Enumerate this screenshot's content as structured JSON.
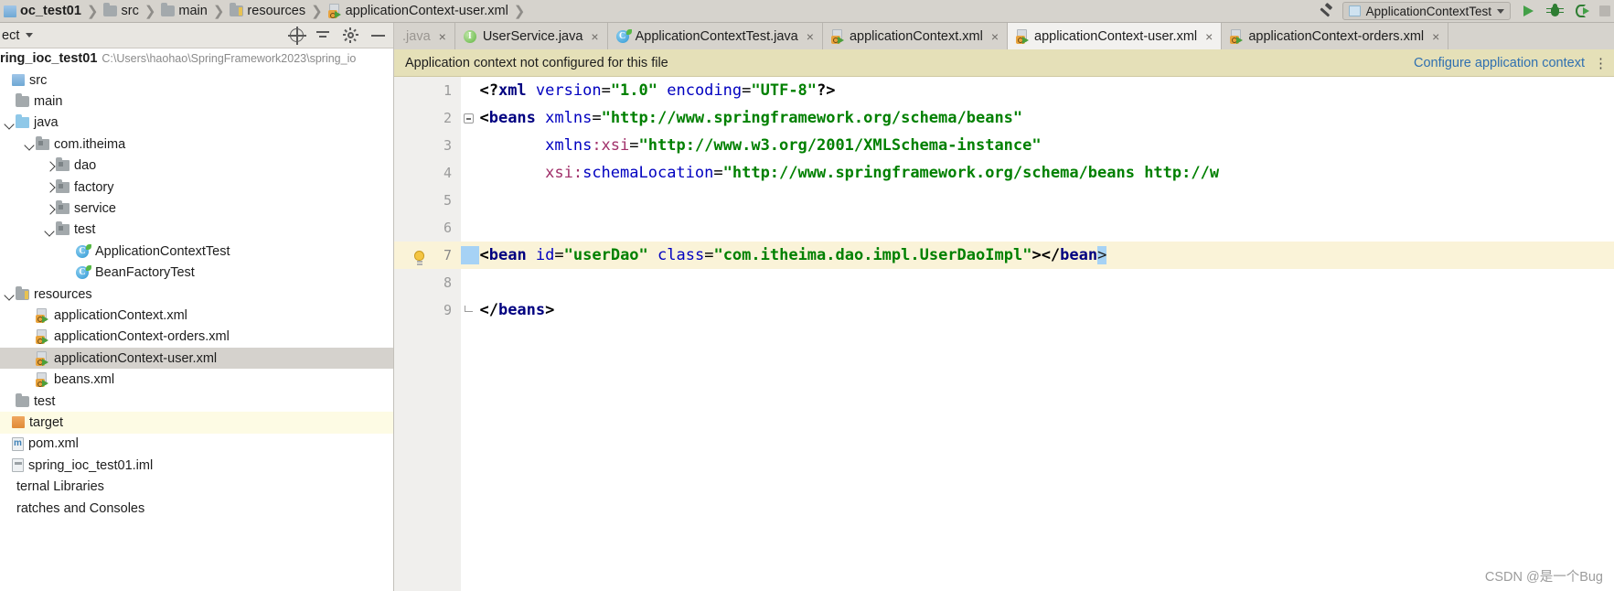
{
  "breadcrumb": {
    "items": [
      {
        "label": "oc_test01",
        "icon": "module-icon",
        "bold": true
      },
      {
        "label": "src",
        "icon": "folder-icon",
        "bold": false
      },
      {
        "label": "main",
        "icon": "folder-icon",
        "bold": false
      },
      {
        "label": "resources",
        "icon": "resources-folder-icon",
        "bold": false
      },
      {
        "label": "applicationContext-user.xml",
        "icon": "xml-file-icon",
        "bold": false
      }
    ]
  },
  "toolbar": {
    "build_icon": "hammer-icon",
    "run_config_name": "ApplicationContextTest",
    "run_config_icon": "run-configuration-icon",
    "dropdown_icon": "chevron-down-icon",
    "run_icon": "run-icon",
    "debug_icon": "debug-icon",
    "coverage_icon": "run-with-coverage-icon",
    "stop_icon": "stop-icon"
  },
  "project_panel": {
    "title": "ect",
    "dropdown_icon": "chevron-down-icon",
    "tools": [
      "locate-icon",
      "collapse-all-icon",
      "settings-icon",
      "hide-icon"
    ],
    "module": {
      "name": "ring_ioc_test01",
      "path": "C:\\Users\\haohao\\SpringFramework2023\\spring_io"
    },
    "tree": [
      {
        "label": "src",
        "indent": 0,
        "arrow": "none",
        "icon": "source-root-icon",
        "state": "normal"
      },
      {
        "label": "main",
        "indent": 1,
        "arrow": "none",
        "icon": "folder-icon",
        "state": "normal"
      },
      {
        "label": "java",
        "indent": 1,
        "arrow": "down",
        "icon": "source-folder-icon",
        "state": "normal"
      },
      {
        "label": "com.itheima",
        "indent": 2,
        "arrow": "down",
        "icon": "package-icon",
        "state": "normal"
      },
      {
        "label": "dao",
        "indent": 3,
        "arrow": "right",
        "icon": "package-icon",
        "state": "normal"
      },
      {
        "label": "factory",
        "indent": 3,
        "arrow": "right",
        "icon": "package-icon",
        "state": "normal"
      },
      {
        "label": "service",
        "indent": 3,
        "arrow": "right",
        "icon": "package-icon",
        "state": "normal"
      },
      {
        "label": "test",
        "indent": 3,
        "arrow": "down",
        "icon": "package-icon",
        "state": "normal"
      },
      {
        "label": "ApplicationContextTest",
        "indent": 4,
        "arrow": "none",
        "icon": "java-class-icon",
        "state": "normal"
      },
      {
        "label": "BeanFactoryTest",
        "indent": 4,
        "arrow": "none",
        "icon": "java-class-icon",
        "state": "normal"
      },
      {
        "label": "resources",
        "indent": 1,
        "arrow": "down",
        "icon": "resources-folder-icon",
        "state": "normal"
      },
      {
        "label": "applicationContext.xml",
        "indent": 2,
        "arrow": "none",
        "icon": "xml-file-icon",
        "state": "normal"
      },
      {
        "label": "applicationContext-orders.xml",
        "indent": 2,
        "arrow": "none",
        "icon": "xml-file-icon",
        "state": "normal"
      },
      {
        "label": "applicationContext-user.xml",
        "indent": 2,
        "arrow": "none",
        "icon": "xml-file-icon",
        "state": "selected"
      },
      {
        "label": "beans.xml",
        "indent": 2,
        "arrow": "none",
        "icon": "xml-file-icon",
        "state": "normal"
      },
      {
        "label": "test",
        "indent": 1,
        "arrow": "none",
        "icon": "folder-icon",
        "state": "normal"
      },
      {
        "label": "target",
        "indent": 0,
        "arrow": "none",
        "icon": "target-folder-icon",
        "state": "warn"
      },
      {
        "label": "pom.xml",
        "indent": 0,
        "arrow": "none",
        "icon": "maven-pom-icon",
        "state": "normal"
      },
      {
        "label": "spring_ioc_test01.iml",
        "indent": 0,
        "arrow": "none",
        "icon": "iml-file-icon",
        "state": "normal"
      },
      {
        "label": "ternal Libraries",
        "indent": 0,
        "arrow": "none",
        "icon": "none",
        "state": "normal"
      },
      {
        "label": "ratches and Consoles",
        "indent": 0,
        "arrow": "none",
        "icon": "none",
        "state": "normal"
      }
    ]
  },
  "editor_tabs": [
    {
      "label": ".java",
      "icon": "java-file-icon",
      "active": false,
      "dimmed": true,
      "close_icon": "close-icon"
    },
    {
      "label": "UserService.java",
      "icon": "java-interface-icon",
      "active": false,
      "dimmed": false,
      "close_icon": "close-icon"
    },
    {
      "label": "ApplicationContextTest.java",
      "icon": "java-class-icon",
      "active": false,
      "dimmed": false,
      "close_icon": "close-icon"
    },
    {
      "label": "applicationContext.xml",
      "icon": "xml-file-icon",
      "active": false,
      "dimmed": false,
      "close_icon": "close-icon"
    },
    {
      "label": "applicationContext-user.xml",
      "icon": "xml-file-icon",
      "active": true,
      "dimmed": false,
      "close_icon": "close-icon"
    },
    {
      "label": "applicationContext-orders.xml",
      "icon": "xml-file-icon",
      "active": false,
      "dimmed": false,
      "close_icon": "close-icon"
    }
  ],
  "banner": {
    "message": "Application context not configured for this file",
    "link": "Configure application context",
    "more_icon": "more-options-icon"
  },
  "editor": {
    "lines": [
      {
        "n": "1",
        "highlight": false
      },
      {
        "n": "2",
        "highlight": false
      },
      {
        "n": "3",
        "highlight": false
      },
      {
        "n": "4",
        "highlight": false
      },
      {
        "n": "5",
        "highlight": false
      },
      {
        "n": "6",
        "highlight": false
      },
      {
        "n": "7",
        "highlight": true
      },
      {
        "n": "8",
        "highlight": false
      },
      {
        "n": "9",
        "highlight": false
      }
    ],
    "code": {
      "l1": "<?xml version=\"1.0\" encoding=\"UTF-8\"?>",
      "l2": "<beans xmlns=\"http://www.springframework.org/schema/beans\"",
      "l3": "xmlns:xsi=\"http://www.w3.org/2001/XMLSchema-instance\"",
      "l4": "xsi:schemaLocation=\"http://www.springframework.org/schema/beans http://w",
      "l7": "<bean id=\"userDao\" class=\"com.itheima.dao.impl.UserDaoImpl\"></bean>",
      "l9": "</beans>"
    },
    "gutter_icons": {
      "line7": "intention-bulb-icon",
      "line2_fold": "fold-collapse-icon",
      "line9_fold": "fold-end-icon"
    }
  },
  "watermark": "CSDN @是一个Bug",
  "colors": {
    "banner_bg": "#e5e0b8",
    "link": "#3070b0",
    "highlight_line": "#faf3d8",
    "selection": "#a6d2f5",
    "tag": "#000080",
    "attr": "#0000c0",
    "value": "#008000",
    "ns": "#a0306a"
  }
}
